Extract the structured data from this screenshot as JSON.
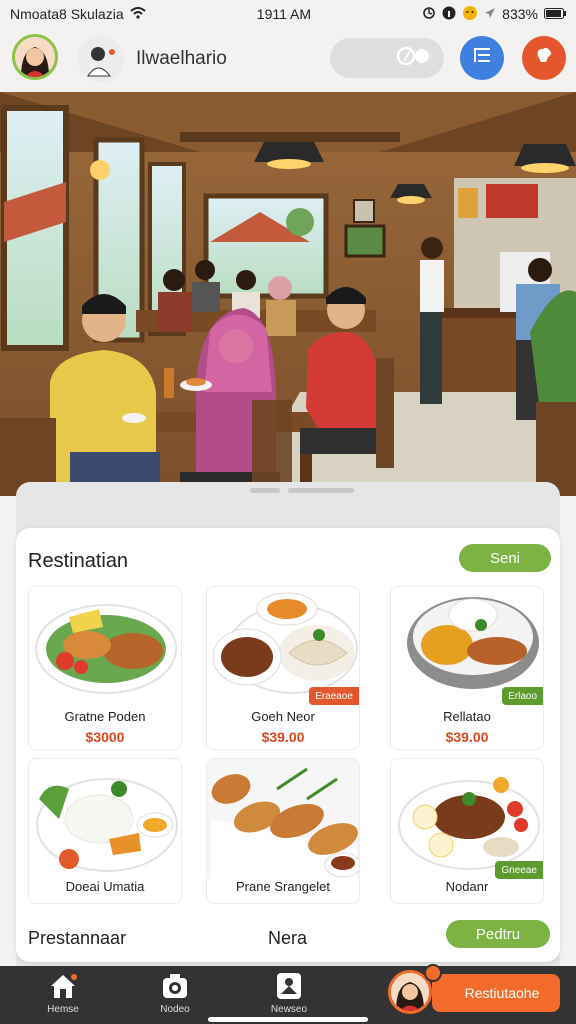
{
  "status_bar": {
    "carrier": "Nmoata8 Skulazia",
    "time": "1911 AM",
    "battery": "833%"
  },
  "header": {
    "title": "Ilwaelhario"
  },
  "panel": {
    "title": "Restinatian",
    "top_button": "Seni",
    "footer_left": "Prestannaar",
    "footer_mid": "Nera",
    "footer_button": "Pedtru"
  },
  "dishes": [
    {
      "name": "Gratne Poden",
      "price": "$3000",
      "badge": ""
    },
    {
      "name": "Goeh Neor",
      "price": "$39.00",
      "badge": "Eraeaoe"
    },
    {
      "name": "Rellatao",
      "price": "$39.00",
      "badge": "Erlaoo"
    },
    {
      "name": "Doeai Umatia",
      "price": "",
      "badge": ""
    },
    {
      "name": "Prane Srangelet",
      "price": "",
      "badge": ""
    },
    {
      "name": "Nodanr",
      "price": "",
      "badge": "Gneeae"
    }
  ],
  "nav": {
    "items": [
      {
        "label": "Hemse",
        "icon": "home-icon"
      },
      {
        "label": "Nodeo",
        "icon": "camera-icon"
      },
      {
        "label": "Newseo",
        "icon": "person-icon"
      }
    ],
    "cta_label": "Restiutaohe"
  },
  "colors": {
    "accent_green": "#7cb342",
    "accent_orange": "#f26b2a",
    "accent_blue": "#3f7fe0",
    "price_red": "#d9481c"
  }
}
